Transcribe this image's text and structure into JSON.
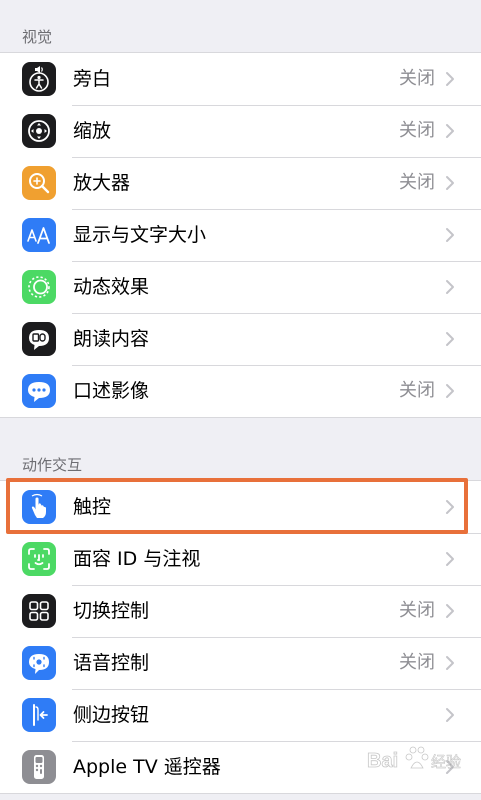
{
  "sections": [
    {
      "header": "视觉",
      "items": [
        {
          "label": "旁白",
          "value": "关闭",
          "icon": "voiceover-icon",
          "color": "#1c1c1e"
        },
        {
          "label": "缩放",
          "value": "关闭",
          "icon": "zoom-icon",
          "color": "#1c1c1e"
        },
        {
          "label": "放大器",
          "value": "关闭",
          "icon": "magnifier-icon",
          "color": "#f0a030"
        },
        {
          "label": "显示与文字大小",
          "value": "",
          "icon": "text-size-icon",
          "color": "#2f7cf6"
        },
        {
          "label": "动态效果",
          "value": "",
          "icon": "motion-icon",
          "color": "#4cd964"
        },
        {
          "label": "朗读内容",
          "value": "",
          "icon": "spoken-content-icon",
          "color": "#1c1c1e"
        },
        {
          "label": "口述影像",
          "value": "关闭",
          "icon": "audio-description-icon",
          "color": "#2f7cf6"
        }
      ]
    },
    {
      "header": "动作交互",
      "items": [
        {
          "label": "触控",
          "value": "",
          "icon": "touch-icon",
          "color": "#2f7cf6"
        },
        {
          "label": "面容 ID 与注视",
          "value": "",
          "icon": "face-id-icon",
          "color": "#4cd964"
        },
        {
          "label": "切换控制",
          "value": "关闭",
          "icon": "switch-control-icon",
          "color": "#1c1c1e"
        },
        {
          "label": "语音控制",
          "value": "关闭",
          "icon": "voice-control-icon",
          "color": "#2f7cf6"
        },
        {
          "label": "侧边按钮",
          "value": "",
          "icon": "side-button-icon",
          "color": "#2f7cf6"
        },
        {
          "label": "Apple TV 遥控器",
          "value": "",
          "icon": "apple-tv-remote-icon",
          "color": "#8e8e93"
        }
      ]
    }
  ],
  "highlight_color": "#e8703a",
  "watermark": "Bai 经验"
}
